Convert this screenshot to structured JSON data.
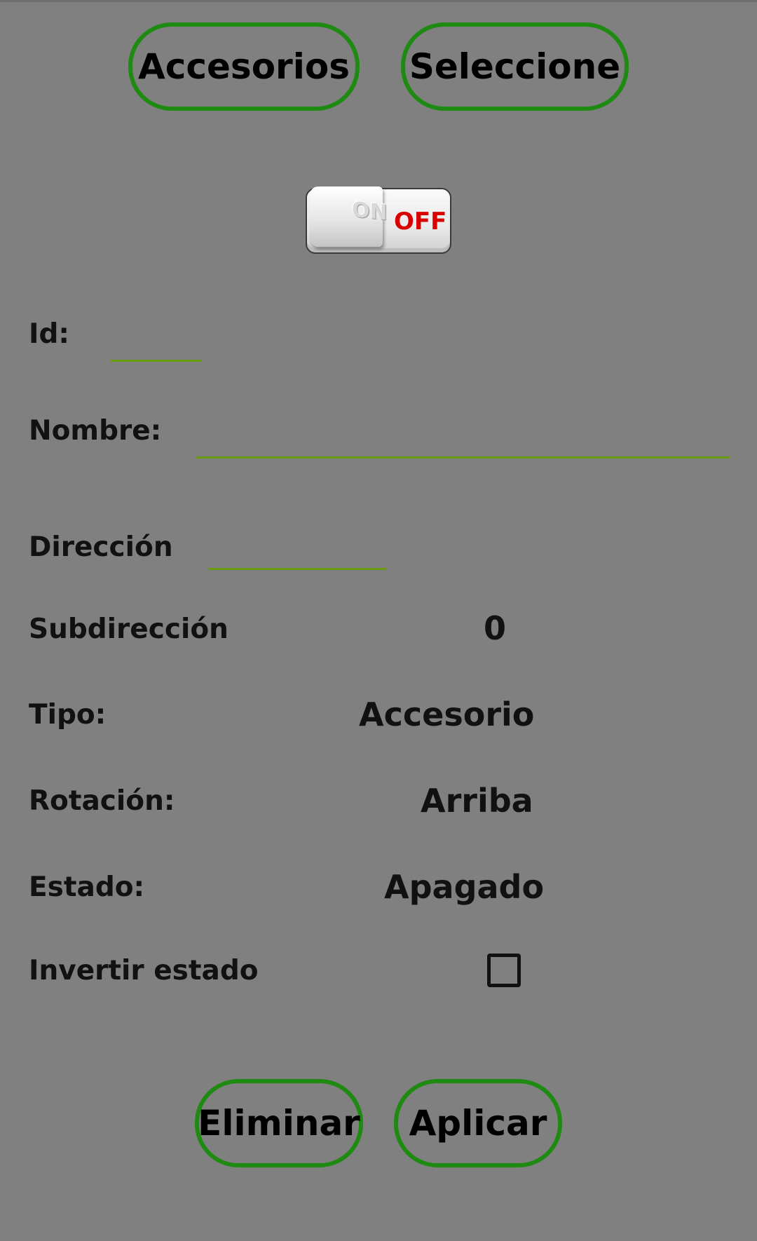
{
  "header": {
    "accesorios_label": "Accesorios",
    "seleccione_label": "Seleccione"
  },
  "switch": {
    "on_label": "ON",
    "off_label": "OFF",
    "state": "off"
  },
  "form": {
    "id_label": "Id:",
    "id_value": "",
    "nombre_label": "Nombre:",
    "nombre_value": "",
    "direccion_label": "Dirección",
    "direccion_value": "",
    "subdireccion_label": "Subdirección",
    "subdireccion_value": "0",
    "tipo_label": "Tipo:",
    "tipo_value": "Accesorio",
    "rotacion_label": "Rotación:",
    "rotacion_value": "Arriba",
    "estado_label": "Estado:",
    "estado_value": "Apagado",
    "invertir_label": "Invertir estado",
    "invertir_checked": false
  },
  "footer": {
    "eliminar_label": "Eliminar",
    "aplicar_label": "Aplicar"
  },
  "colors": {
    "background": "#808080",
    "button_border": "#1f8a12",
    "field_underline": "#6a9a10",
    "off_text": "#d80000"
  }
}
